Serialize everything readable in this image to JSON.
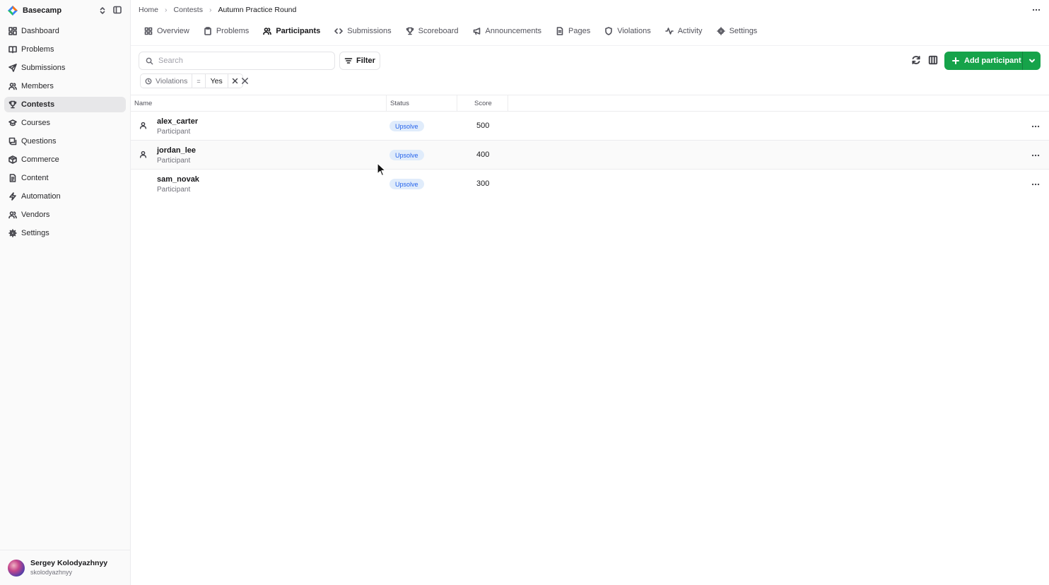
{
  "app": {
    "name": "Basecamp",
    "accent": "#16a34a"
  },
  "sidebar": {
    "items": [
      {
        "label": "Dashboard",
        "icon": "dashboard-icon",
        "active": false
      },
      {
        "label": "Problems",
        "icon": "book-icon",
        "active": false
      },
      {
        "label": "Submissions",
        "icon": "send-icon",
        "active": false
      },
      {
        "label": "Members",
        "icon": "users-icon",
        "active": false
      },
      {
        "label": "Contests",
        "icon": "trophy-icon",
        "active": true
      },
      {
        "label": "Courses",
        "icon": "graduation-cap-icon",
        "active": false
      },
      {
        "label": "Questions",
        "icon": "message-question-icon",
        "active": false
      },
      {
        "label": "Commerce",
        "icon": "package-icon",
        "active": false
      },
      {
        "label": "Content",
        "icon": "file-text-icon",
        "active": false
      },
      {
        "label": "Automation",
        "icon": "zap-icon",
        "active": false
      },
      {
        "label": "Vendors",
        "icon": "users-icon",
        "active": false
      },
      {
        "label": "Settings",
        "icon": "gear-icon",
        "active": false
      }
    ],
    "user": {
      "name": "Sergey Kolodyazhnyy",
      "handle": "skolodyazhnyy"
    }
  },
  "breadcrumb": {
    "items": [
      "Home",
      "Contests"
    ],
    "current": "Autumn Practice Round"
  },
  "tabs": [
    {
      "label": "Overview",
      "icon": "layout-grid-icon",
      "active": false
    },
    {
      "label": "Problems",
      "icon": "clipboard-icon",
      "active": false
    },
    {
      "label": "Participants",
      "icon": "users-icon",
      "active": true
    },
    {
      "label": "Submissions",
      "icon": "code-icon",
      "active": false
    },
    {
      "label": "Scoreboard",
      "icon": "trophy-icon",
      "active": false
    },
    {
      "label": "Announcements",
      "icon": "megaphone-icon",
      "active": false
    },
    {
      "label": "Pages",
      "icon": "file-icon",
      "active": false
    },
    {
      "label": "Violations",
      "icon": "shield-icon",
      "active": false
    },
    {
      "label": "Activity",
      "icon": "activity-icon",
      "active": false
    },
    {
      "label": "Settings",
      "icon": "gear-icon",
      "active": false
    }
  ],
  "toolbar": {
    "search_placeholder": "Search",
    "filter_label": "Filter",
    "add_label": "Add participant"
  },
  "active_filter": {
    "field": "Violations",
    "operator": "=",
    "value": "Yes"
  },
  "table": {
    "columns": [
      "Name",
      "Status",
      "Score"
    ],
    "rows": [
      {
        "name": "alex_carter",
        "role": "Participant",
        "status": "Upsolve",
        "score": "500",
        "has_icon": true
      },
      {
        "name": "jordan_lee",
        "role": "Participant",
        "status": "Upsolve",
        "score": "400",
        "has_icon": true
      },
      {
        "name": "sam_novak",
        "role": "Participant",
        "status": "Upsolve",
        "score": "300",
        "has_icon": false
      }
    ]
  }
}
